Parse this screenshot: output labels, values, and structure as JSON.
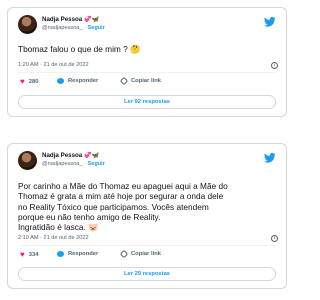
{
  "tweets": [
    {
      "author_name": "Nadja Pessoa",
      "author_emoji": "💞🦋",
      "handle": "@nadjapessoa_ ·",
      "follow_label": "Seguir",
      "text": "Tbomaz falou o que de mim ? 🤔",
      "timestamp": "1:20 AM · 21 de out de 2022",
      "likes": "280",
      "reply_label": "Responder",
      "copy_link_label": "Copiar link",
      "read_replies_label": "Ler 92 respostas"
    },
    {
      "author_name": "Nadja Pessoa",
      "author_emoji": "💞🦋",
      "handle": "@nadjapessoa_ ·",
      "follow_label": "Seguir",
      "text": "Por carinho a Mãe do Thomaz eu apaguei aqui a Mãe do\nThomaz é grata a mim até hoje por segurar a onda dele\nno Reality Tóxico que participamos.  Vocês atendem\nporque eu não tenho amigo de Reality.\nIngratidão é lasca. 🐷",
      "timestamp": "2:10 AM · 21 de out de 2022",
      "likes": "334",
      "reply_label": "Responder",
      "copy_link_label": "Copiar link",
      "read_replies_label": "Ler 29 respostas"
    }
  ],
  "colors": {
    "brand": "#1d9bf0",
    "like": "#f91880",
    "muted": "#536471"
  },
  "icons": {
    "logo": "twitter-bird-icon",
    "like": "heart-icon",
    "reply": "speech-bubble-icon",
    "copy": "link-icon",
    "info": "info-icon"
  }
}
